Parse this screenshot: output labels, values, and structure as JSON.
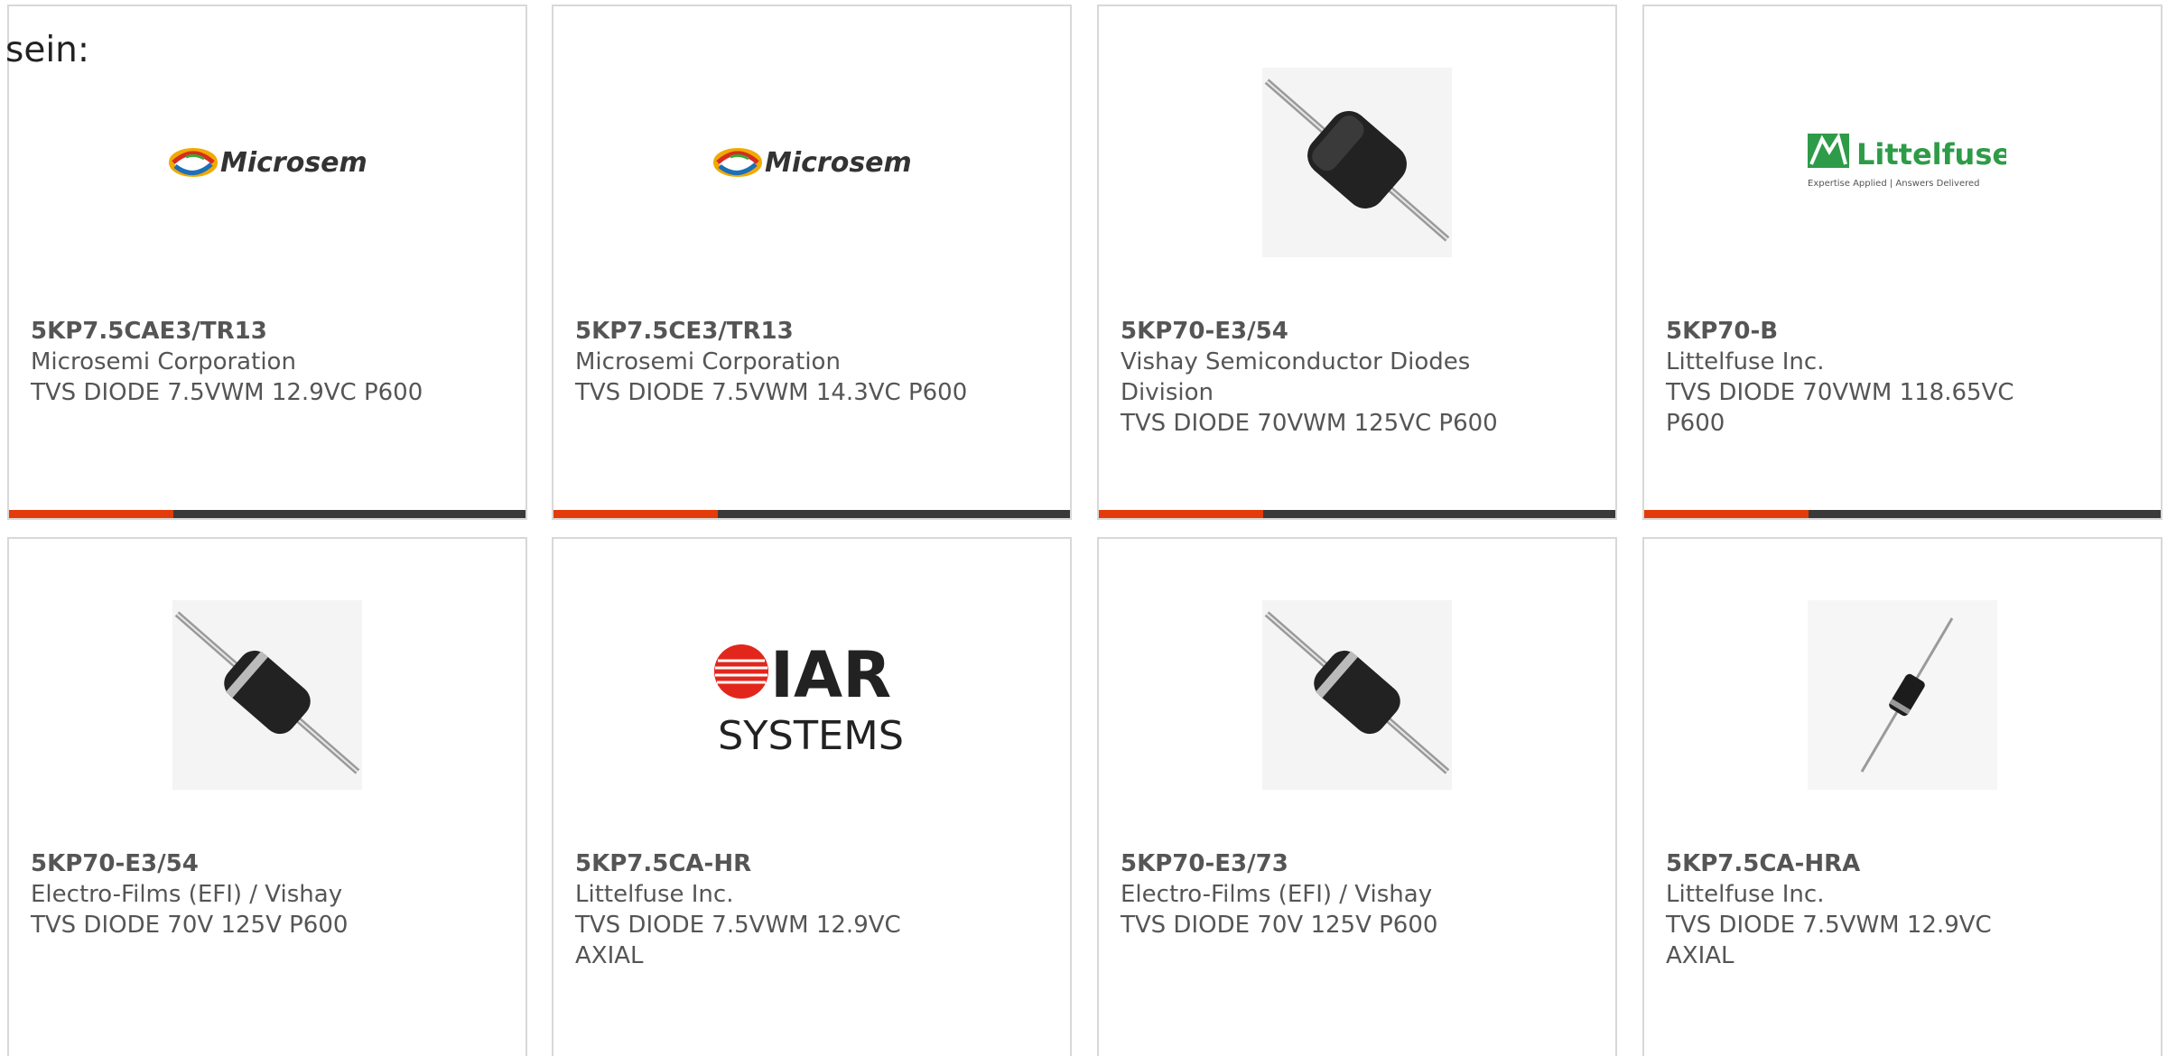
{
  "intro_text": "sein:",
  "colors": {
    "accent": "#e33c0a",
    "bar": "#3a3a3a",
    "text": "#555555",
    "border": "#d8d8d8"
  },
  "products": [
    {
      "part": "5KP7.5CAE3/TR13",
      "manufacturer": "Microsemi Corporation",
      "description": "TVS DIODE 7.5VWM 12.9VC P600",
      "image": "microsemi-logo",
      "logo_text": "Microsemi"
    },
    {
      "part": "5KP7.5CE3/TR13",
      "manufacturer": "Microsemi Corporation",
      "description": "TVS DIODE 7.5VWM 14.3VC P600",
      "image": "microsemi-logo",
      "logo_text": "Microsemi"
    },
    {
      "part": "5KP70-E3/54",
      "manufacturer": "Vishay Semiconductor Diodes Division",
      "description": "TVS DIODE 70VWM 125VC P600",
      "image": "axial-diode-photo"
    },
    {
      "part": "5KP70-B",
      "manufacturer": "Littelfuse Inc.",
      "description": "TVS DIODE 70VWM 118.65VC P600",
      "image": "littelfuse-logo",
      "logo_text": "Littelfuse",
      "logo_tagline": "Expertise Applied | Answers Delivered"
    },
    {
      "part": "5KP70-E3/54",
      "manufacturer": "Electro-Films (EFI) / Vishay",
      "description": "TVS DIODE 70V 125V P600",
      "image": "axial-diode-photo-banded"
    },
    {
      "part": "5KP7.5CA-HR",
      "manufacturer": "Littelfuse Inc.",
      "description": "TVS DIODE 7.5VWM 12.9VC AXIAL",
      "image": "iar-systems-logo",
      "logo_text": "IAR",
      "logo_text_2": "SYSTEMS"
    },
    {
      "part": "5KP70-E3/73",
      "manufacturer": "Electro-Films (EFI) / Vishay",
      "description": "TVS DIODE 70V 125V P600",
      "image": "axial-diode-photo-banded"
    },
    {
      "part": "5KP7.5CA-HRA",
      "manufacturer": "Littelfuse Inc.",
      "description": "TVS DIODE 7.5VWM 12.9VC AXIAL",
      "image": "small-axial-diode-photo"
    }
  ]
}
